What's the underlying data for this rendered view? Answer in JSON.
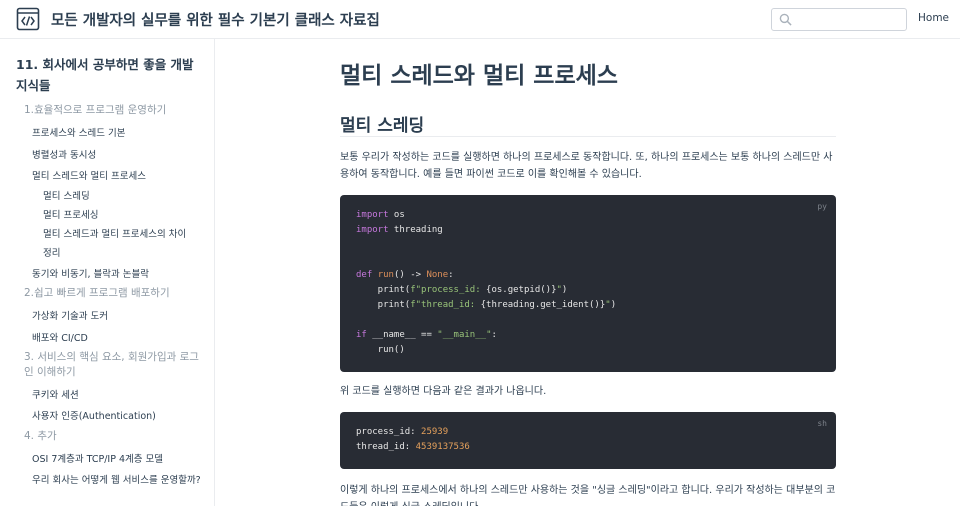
{
  "navbar": {
    "title": "모든 개발자의 실무를 위한 필수 기본기 클래스 자료집",
    "search_placeholder": "",
    "home_label": "Home"
  },
  "sidebar": {
    "heading": "11. 회사에서 공부하면 좋을 개발 지식들",
    "group1": "1.효율적으로 프로그램 운영하기",
    "group1_items": [
      "프로세스와 스레드 기본",
      "병렬성과 동시성",
      "멀티 스레드와 멀티 프로세스"
    ],
    "group1_subitems": [
      "멀티 스레딩",
      "멀티 프로세싱",
      "멀티 스레드과 멀티 프로세스의 차이",
      "정리"
    ],
    "group1_last": "동기와 비동기, 블락과 논블락",
    "group2": "2.쉽고 빠르게 프로그램 배포하기",
    "group2_items": [
      "가상화 기술과 도커",
      "배포와 CI/CD"
    ],
    "group3": "3. 서비스의 핵심 요소, 회원가입과 로그인 이해하기",
    "group3_items": [
      "쿠키와 세션",
      "사용자 인증(Authentication)"
    ],
    "group4": "4. 추가",
    "group4_items": [
      "OSI 7계층과 TCP/IP 4계층 모델",
      "우리 회사는 어떻게 웹 서비스를 운영할까?"
    ]
  },
  "main": {
    "page_title": "멀티 스레드와 멀티 프로세스",
    "section_title": "멀티 스레딩",
    "para1": "보통 우리가 작성하는 코드를 실행하면 하나의 프로세스로 동작합니다. 또, 하나의 프로세스는 보통 하나의 스레드만 사용하여 동작합니다. 예를 들면 파이썬 코드로 이를 확인해볼 수 있습니다.",
    "code1_lang": "py",
    "code1": {
      "l1a": "import",
      "l1b": " os",
      "l2a": "import",
      "l2b": " threading",
      "l5a": "def",
      "l5b": " ",
      "l5c": "run",
      "l5d": "() -> ",
      "l5e": "None",
      "l5f": ":",
      "l6a": "    print(",
      "l6b": "f\"process_id: ",
      "l6c": "{os.getpid()}",
      "l6d": "\"",
      "l6e": ")",
      "l7a": "    print(",
      "l7b": "f\"thread_id: ",
      "l7c": "{threading.get_ident()}",
      "l7d": "\"",
      "l7e": ")",
      "l9a": "if",
      "l9b": " __name__ == ",
      "l9c": "\"__main__\"",
      "l9d": ":",
      "l10": "    run()"
    },
    "para2": "위 코드를 실행하면 다음과 같은 결과가 나옵니다.",
    "code2_lang": "sh",
    "code2": {
      "l1a": "process_id: ",
      "l1b": "25939",
      "l2a": "thread_id: ",
      "l2b": "4539137536"
    },
    "para3": "이렇게 하나의 프로세스에서 하나의 스레드만 사용하는 것을 \"싱글 스레딩\"이라고 합니다. 우리가 작성하는 대부분의 코드들은 이렇게 싱글 스레딩입니다."
  },
  "colors": {
    "text": "#2c3e50",
    "muted": "#8e99a4",
    "code_bg": "#282c34",
    "keyword": "#c678dd",
    "function": "#dd8f5a",
    "string": "#98c379",
    "number": "#e5a15c"
  },
  "icons": {
    "logo": "code-brackets-icon",
    "search": "search-icon"
  }
}
